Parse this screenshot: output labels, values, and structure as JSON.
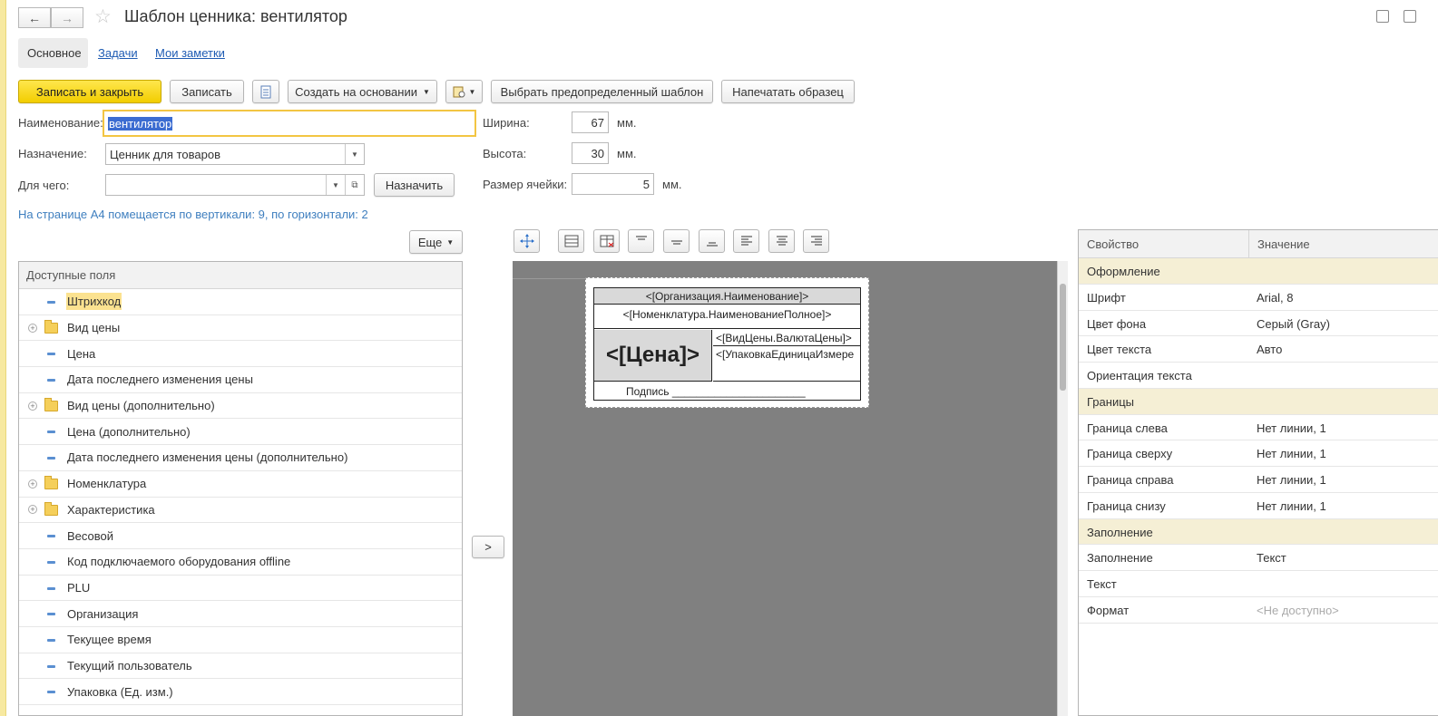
{
  "window": {
    "title": "Шаблон ценника: вентилятор"
  },
  "tabs": [
    {
      "label": "Основное"
    },
    {
      "label": "Задачи"
    },
    {
      "label": "Мои заметки"
    }
  ],
  "toolbar": {
    "save_close": "Записать и закрыть",
    "save": "Записать",
    "create_based": "Создать на основании",
    "choose_template": "Выбрать предопределенный шаблон",
    "print_sample": "Напечатать образец"
  },
  "form": {
    "name_label": "Наименование:",
    "name_value": "вентилятор",
    "purpose_label": "Назначение:",
    "purpose_value": "Ценник для товаров",
    "for_label": "Для чего:",
    "for_value": "",
    "assign_button": "Назначить",
    "width_label": "Ширина:",
    "width_value": "67",
    "height_label": "Высота:",
    "height_value": "30",
    "cell_label": "Размер ячейки:",
    "cell_value": "5",
    "unit": "мм.",
    "info": "На странице А4 помещается по вертикали: 9, по горизонтали: 2"
  },
  "fields_panel": {
    "more_button": "Еще",
    "header": "Доступные поля",
    "move_button": ">",
    "items": [
      {
        "label": "Штрихкод",
        "type": "leaf",
        "highlighted": true
      },
      {
        "label": "Вид цены",
        "type": "folder"
      },
      {
        "label": "Цена",
        "type": "leaf"
      },
      {
        "label": "Дата последнего изменения цены",
        "type": "leaf"
      },
      {
        "label": "Вид цены (дополнительно)",
        "type": "folder"
      },
      {
        "label": "Цена (дополнительно)",
        "type": "leaf"
      },
      {
        "label": "Дата последнего изменения цены (дополнительно)",
        "type": "leaf"
      },
      {
        "label": "Номенклатура",
        "type": "folder"
      },
      {
        "label": "Характеристика",
        "type": "folder"
      },
      {
        "label": "Весовой",
        "type": "leaf"
      },
      {
        "label": "Код подключаемого оборудования offline",
        "type": "leaf"
      },
      {
        "label": "PLU",
        "type": "leaf"
      },
      {
        "label": "Организация",
        "type": "leaf"
      },
      {
        "label": "Текущее время",
        "type": "leaf"
      },
      {
        "label": "Текущий пользователь",
        "type": "leaf"
      },
      {
        "label": "Упаковка (Ед. изм.)",
        "type": "leaf"
      }
    ]
  },
  "template": {
    "org": "<[Организация.Наименование]>",
    "nomenclature": "<[Номенклатура.НаименованиеПолное]>",
    "price": "<[Цена]>",
    "currency": "<[ВидЦены.ВалютаЦены]>",
    "unit": "<[УпаковкаЕдиницаИзмере",
    "signature": "Подпись ______________________"
  },
  "properties": {
    "col_property": "Свойство",
    "col_value": "Значение",
    "rows": [
      {
        "key": "Оформление",
        "value": "",
        "group": true
      },
      {
        "key": "Шрифт",
        "value": "Arial, 8"
      },
      {
        "key": "Цвет фона",
        "value": "Серый (Gray)"
      },
      {
        "key": "Цвет текста",
        "value": "Авто"
      },
      {
        "key": "Ориентация текста",
        "value": ""
      },
      {
        "key": "Границы",
        "value": "",
        "group": true
      },
      {
        "key": "Граница слева",
        "value": "Нет линии, 1"
      },
      {
        "key": "Граница сверху",
        "value": "Нет линии, 1"
      },
      {
        "key": "Граница справа",
        "value": "Нет линии, 1"
      },
      {
        "key": "Граница снизу",
        "value": "Нет линии, 1"
      },
      {
        "key": "Заполнение",
        "value": "",
        "group": true
      },
      {
        "key": "Заполнение",
        "value": "Текст"
      },
      {
        "key": "Текст",
        "value": ""
      },
      {
        "key": "Формат",
        "value": "<Не доступно>",
        "muted": true
      }
    ]
  },
  "colors": {
    "accent_yellow": "#f2cd00",
    "link_blue": "#1e5bb3",
    "info_blue": "#3f7fbf",
    "canvas_gray": "#808080",
    "group_row": "#f5efd5"
  }
}
